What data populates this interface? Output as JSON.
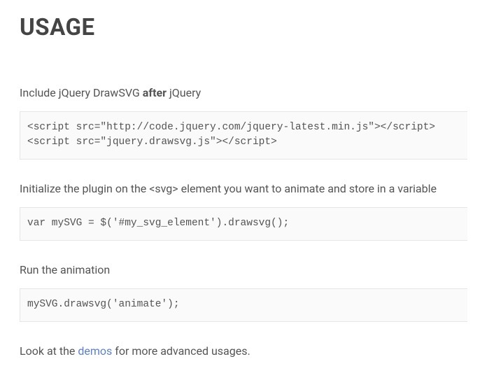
{
  "heading": "USAGE",
  "p1_before": "Include jQuery DrawSVG ",
  "p1_bold": "after",
  "p1_after": " jQuery",
  "code1": "<script src=\"http://code.jquery.com/jquery-latest.min.js\"></script>\n<script src=\"jquery.drawsvg.js\"></script>",
  "p2_before": "Initialize the plugin on the ",
  "p2_code": "<svg>",
  "p2_after": " element you want to animate and store in a variable",
  "code2": "var mySVG = $('#my_svg_element').drawsvg();",
  "p3": "Run the animation",
  "code3": "mySVG.drawsvg('animate');",
  "p4_before": "Look at the ",
  "p4_link": "demos",
  "p4_after": " for more advanced usages."
}
